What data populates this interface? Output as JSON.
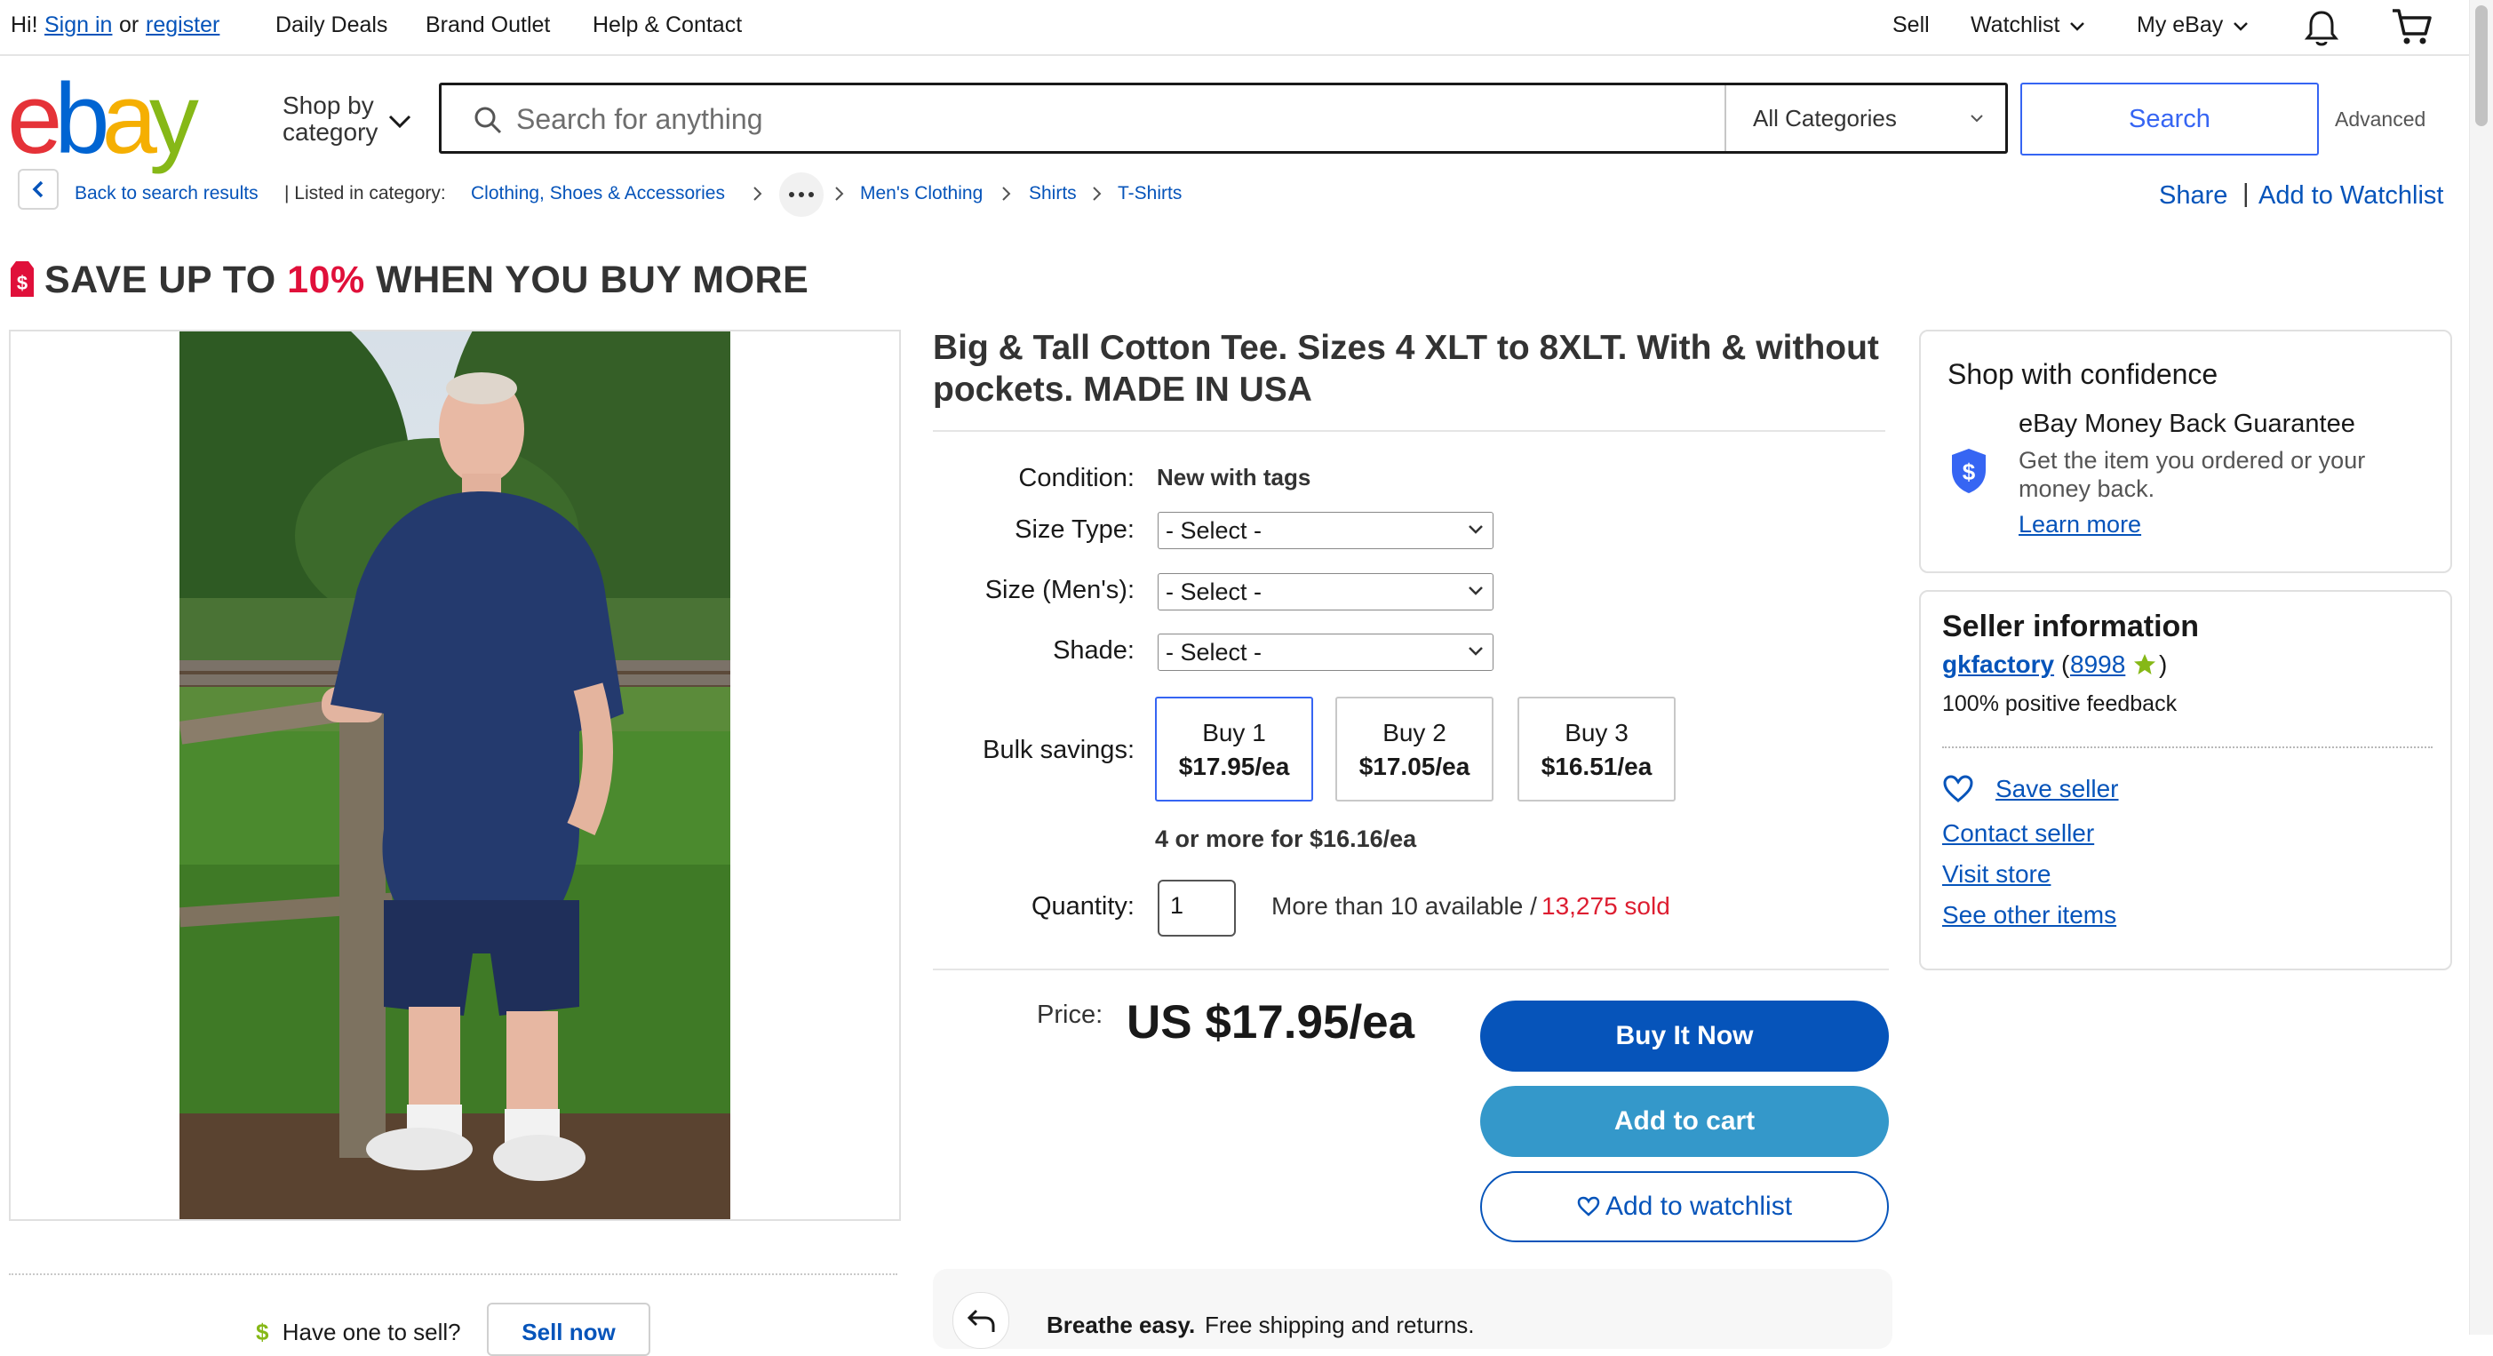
{
  "topnav": {
    "greeting": "Hi!",
    "sign_in": "Sign in",
    "or": "or",
    "register": "register",
    "daily_deals": "Daily Deals",
    "brand_outlet": "Brand Outlet",
    "help_contact": "Help & Contact",
    "sell": "Sell",
    "watchlist": "Watchlist",
    "my_ebay": "My eBay"
  },
  "header": {
    "logo_letters": [
      "e",
      "b",
      "a",
      "y"
    ],
    "logo_colors": [
      "#e53238",
      "#0064d2",
      "#f5af02",
      "#86b817"
    ],
    "shop_by_line1": "Shop by",
    "shop_by_line2": "category",
    "search_placeholder": "Search for anything",
    "category_selected": "All Categories",
    "search_button": "Search",
    "advanced": "Advanced"
  },
  "breadcrumb": {
    "back": "Back to search results",
    "listed_in": "| Listed in category:",
    "items": [
      "Clothing, Shoes & Accessories",
      "Men's Clothing",
      "Shirts",
      "T-Shirts"
    ],
    "share": "Share",
    "add_to_watchlist": "Add to Watchlist"
  },
  "promo": {
    "prefix": "SAVE UP TO ",
    "percent": "10%",
    "suffix": " WHEN YOU BUY MORE"
  },
  "listing": {
    "title": "Big & Tall Cotton Tee. Sizes 4 XLT to 8XLT. With & without pockets. MADE IN USA",
    "condition_label": "Condition:",
    "condition_value": "New with tags",
    "size_type_label": "Size Type:",
    "size_mens_label": "Size (Men's):",
    "shade_label": "Shade:",
    "select_placeholder": "- Select -",
    "bulk_label": "Bulk savings:",
    "bulk_options": [
      {
        "qty": "Buy 1",
        "price": "$17.95/ea"
      },
      {
        "qty": "Buy 2",
        "price": "$17.05/ea"
      },
      {
        "qty": "Buy 3",
        "price": "$16.51/ea"
      }
    ],
    "bulk_more": "4 or more for $16.16/ea",
    "quantity_label": "Quantity:",
    "quantity_value": "1",
    "availability": "More than 10 available /",
    "sold": "13,275 sold",
    "price_label": "Price:",
    "price_value": "US $17.95/ea",
    "buy_now": "Buy It Now",
    "add_to_cart": "Add to cart",
    "add_to_watchlist": "Add to watchlist",
    "breathe_easy": "Breathe easy.",
    "shipping_text": "Free shipping and returns."
  },
  "sell_prompt": {
    "question": "Have one to sell?",
    "button": "Sell now"
  },
  "confidence": {
    "heading": "Shop with confidence",
    "guarantee_title": "eBay Money Back Guarantee",
    "guarantee_line1": "Get the item you ordered or your",
    "guarantee_line2": "money back.",
    "learn_more": "Learn more"
  },
  "seller": {
    "heading": "Seller information",
    "name": "gkfactory",
    "feedback_score": "8998",
    "positive": "100% positive feedback",
    "save_seller": "Save seller",
    "contact": "Contact seller",
    "visit_store": "Visit store",
    "other_items": "See other items"
  },
  "colors": {
    "link": "#0654ba",
    "primary_button": "#0654ba",
    "cart_button": "#3498ca",
    "sold_red": "#dd1e31",
    "promo_red": "#e0103a"
  }
}
